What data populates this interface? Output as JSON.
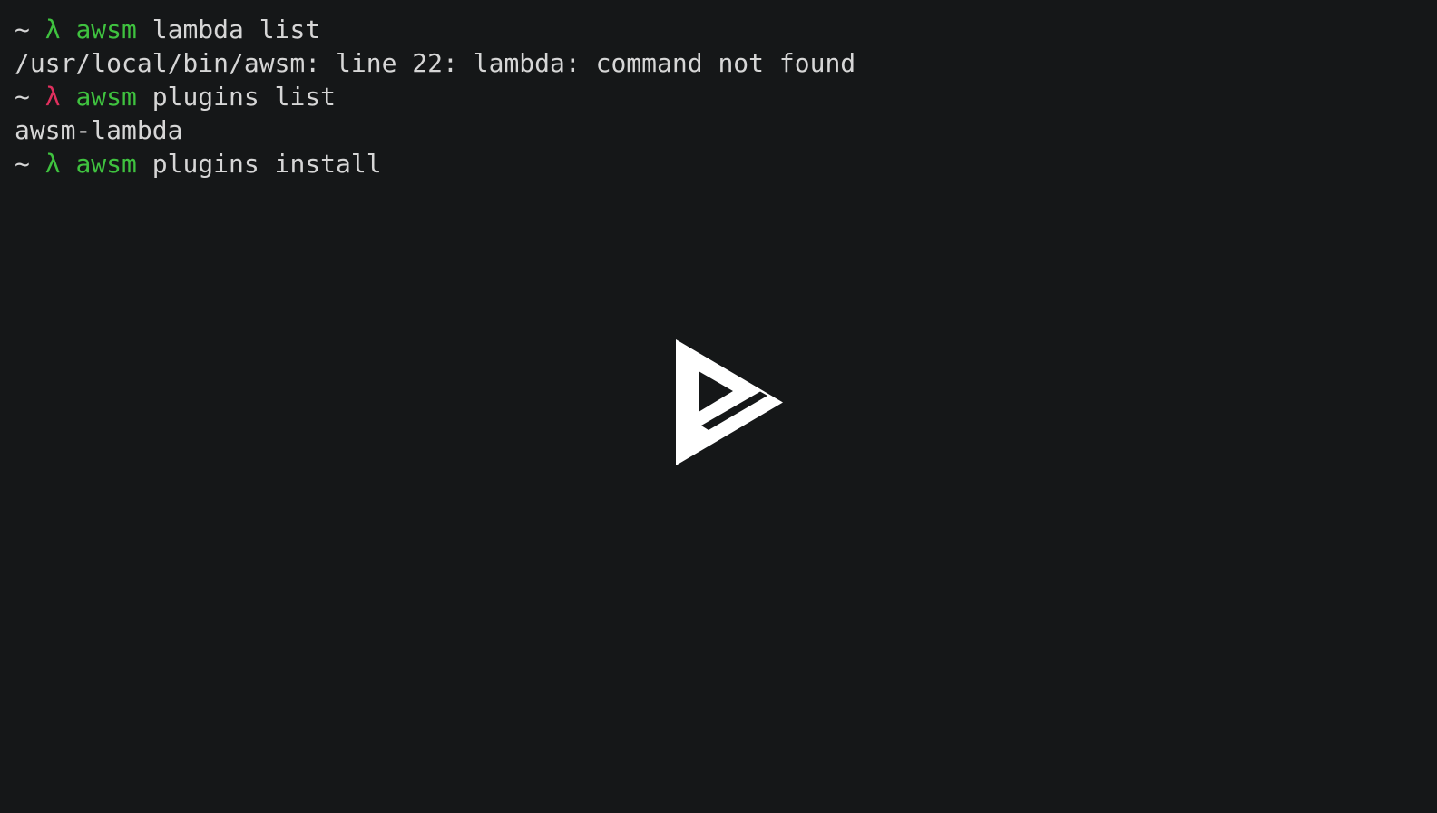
{
  "terminal": {
    "background_color": "#151718",
    "foreground_color": "#d6d6d6",
    "prompt_ok_color": "#3fc23f",
    "prompt_error_color": "#e0305e",
    "lines": [
      {
        "name": "command-line-1",
        "segments": [
          {
            "text": "~ ",
            "style": "plain"
          },
          {
            "text": "λ",
            "style": "green"
          },
          {
            "text": " ",
            "style": "plain"
          },
          {
            "text": "awsm",
            "style": "green"
          },
          {
            "text": " lambda list",
            "style": "plain"
          }
        ],
        "plain": "~ λ awsm lambda list"
      },
      {
        "name": "output-line-error",
        "segments": [
          {
            "text": "/usr/local/bin/awsm: line 22: lambda: command not found",
            "style": "plain"
          }
        ],
        "plain": "/usr/local/bin/awsm: line 22: lambda: command not found"
      },
      {
        "name": "command-line-2",
        "segments": [
          {
            "text": "~ ",
            "style": "plain"
          },
          {
            "text": "λ",
            "style": "pink"
          },
          {
            "text": " ",
            "style": "plain"
          },
          {
            "text": "awsm",
            "style": "green"
          },
          {
            "text": " plugins list",
            "style": "plain"
          }
        ],
        "plain": "~ λ awsm plugins list"
      },
      {
        "name": "output-line-plugin",
        "segments": [
          {
            "text": "awsm-lambda",
            "style": "plain"
          }
        ],
        "plain": "awsm-lambda"
      },
      {
        "name": "command-line-3",
        "segments": [
          {
            "text": "~ ",
            "style": "plain"
          },
          {
            "text": "λ",
            "style": "green"
          },
          {
            "text": " ",
            "style": "plain"
          },
          {
            "text": "awsm",
            "style": "green"
          },
          {
            "text": " plugins install",
            "style": "plain"
          }
        ],
        "plain": "~ λ awsm plugins install"
      }
    ]
  },
  "overlay": {
    "play_button": {
      "icon": "play-triangle-terminal-icon",
      "label": "Play",
      "color": "#ffffff"
    }
  }
}
